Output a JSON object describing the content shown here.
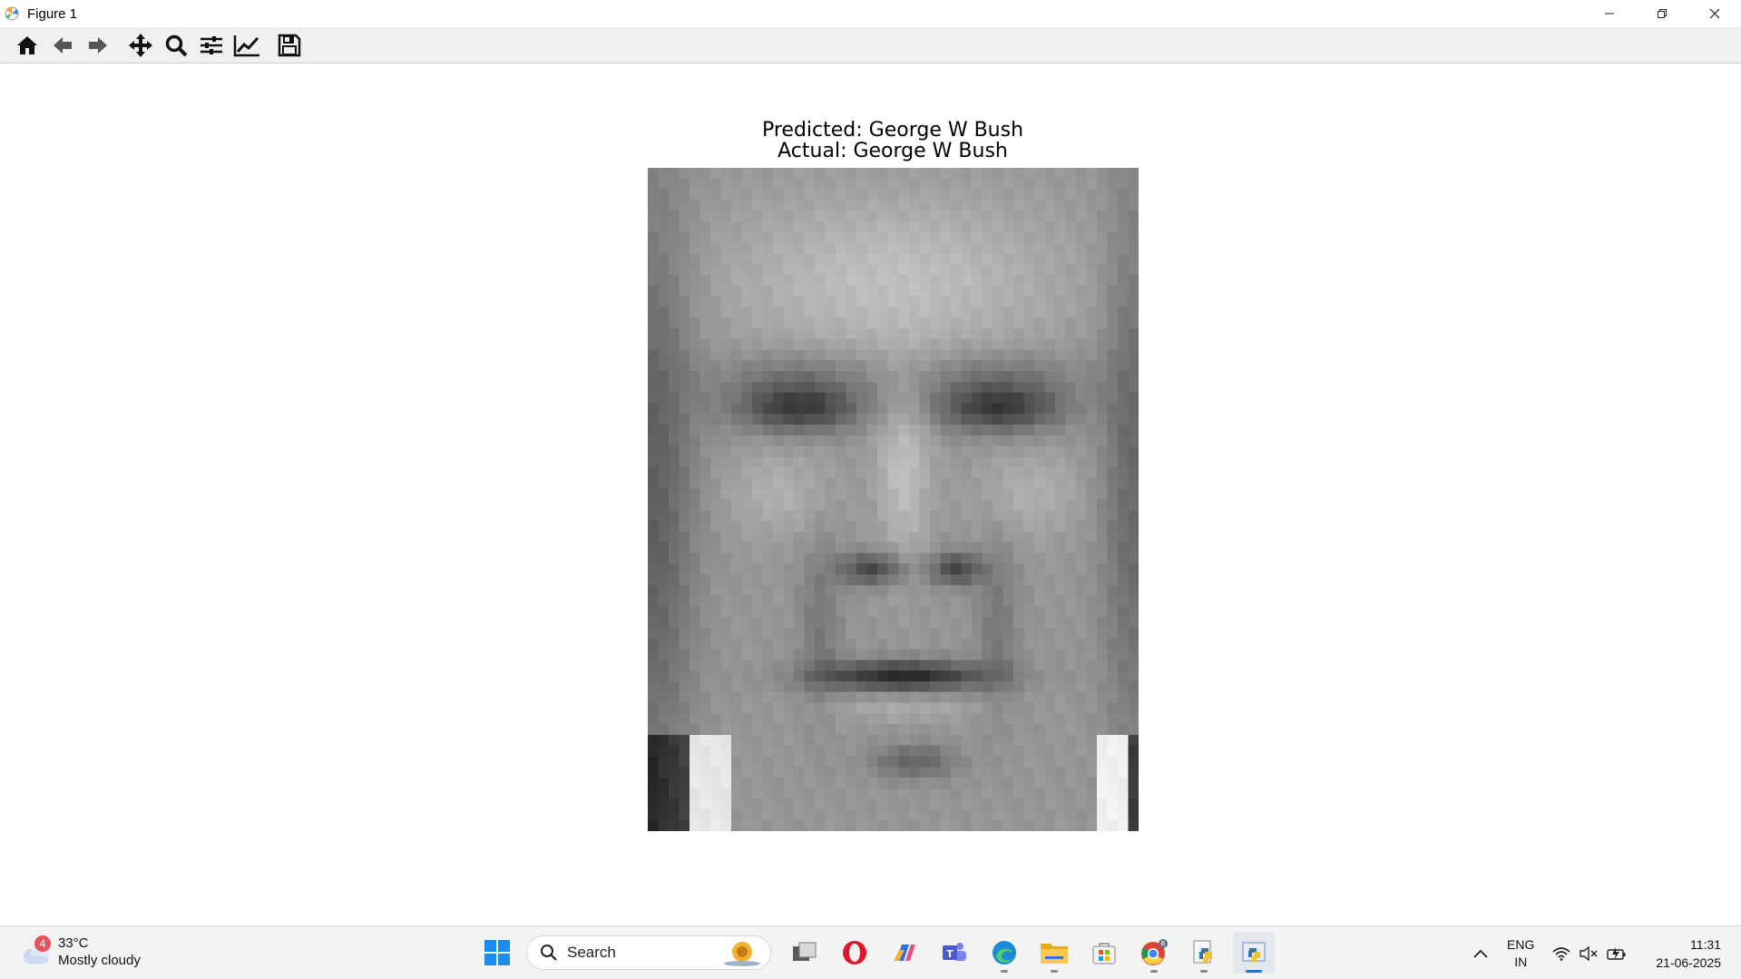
{
  "window": {
    "title": "Figure 1"
  },
  "toolbar": {
    "buttons": [
      {
        "icon": "home-icon",
        "tooltip": "Home"
      },
      {
        "icon": "back-arrow-icon",
        "tooltip": "Back"
      },
      {
        "icon": "forward-arrow-icon",
        "tooltip": "Forward"
      },
      {
        "icon": "pan-icon",
        "tooltip": "Pan"
      },
      {
        "icon": "zoom-icon",
        "tooltip": "Zoom"
      },
      {
        "icon": "subplots-icon",
        "tooltip": "Subplots"
      },
      {
        "icon": "edit-axis-icon",
        "tooltip": "Customize"
      },
      {
        "icon": "save-icon",
        "tooltip": "Save"
      }
    ]
  },
  "figure": {
    "title_line1": "Predicted: George W Bush",
    "title_line2": "Actual: George W Bush",
    "image_type": "grayscale pixelated face portrait"
  },
  "taskbar": {
    "weather": {
      "temperature": "33°C",
      "condition": "Mostly cloudy",
      "badge": "4"
    },
    "search_placeholder": "Search",
    "apps": [
      "task-view-icon",
      "opera-icon",
      "copilot-icon",
      "teams-icon",
      "edge-icon",
      "file-explorer-icon",
      "store-icon",
      "chrome-icon",
      "python-icon",
      "python-figure-icon"
    ],
    "language": {
      "line1": "ENG",
      "line2": "IN"
    },
    "clock": {
      "time": "11:31",
      "date": "21-06-2025"
    }
  }
}
